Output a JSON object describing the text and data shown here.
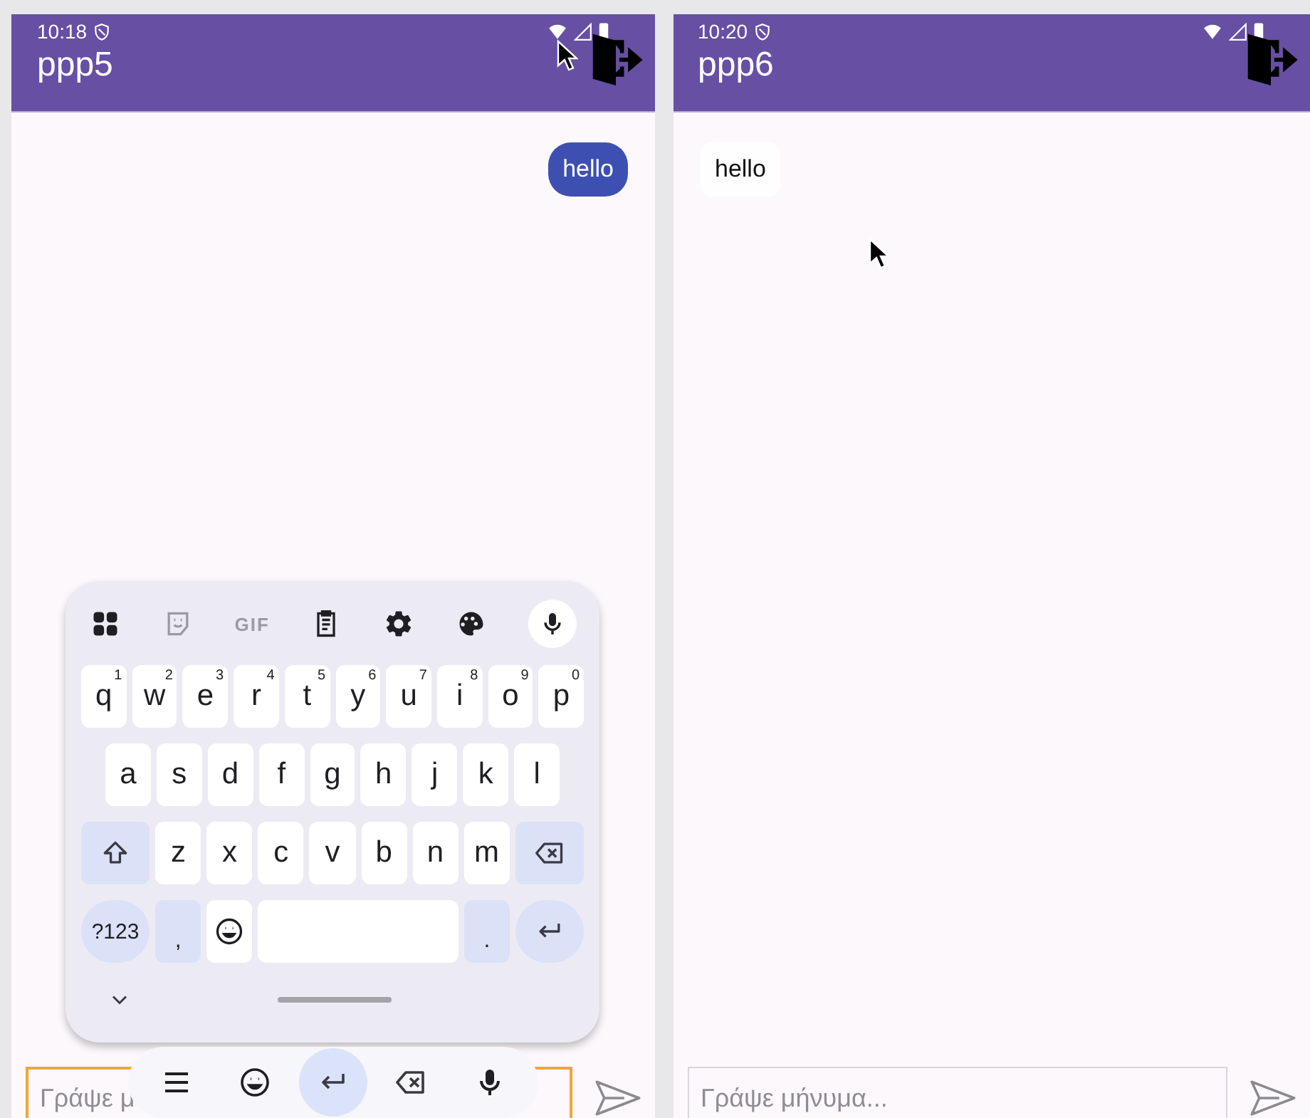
{
  "panels": [
    {
      "status": {
        "time": "10:18"
      },
      "title": "ppp5",
      "messages": [
        {
          "kind": "sent",
          "text": "hello"
        }
      ],
      "input": {
        "placeholder": "Γράψε μ",
        "focused": true
      },
      "keyboard": {
        "toolbar": [
          {
            "kind": "apps"
          },
          {
            "kind": "sticker"
          },
          {
            "kind": "gif",
            "label": "GIF"
          },
          {
            "kind": "clipboard"
          },
          {
            "kind": "settings"
          },
          {
            "kind": "palette"
          },
          {
            "kind": "mic"
          }
        ],
        "rows": [
          {
            "keys": [
              {
                "kind": "letter",
                "label": "q",
                "hint": "1"
              },
              {
                "kind": "letter",
                "label": "w",
                "hint": "2"
              },
              {
                "kind": "letter",
                "label": "e",
                "hint": "3"
              },
              {
                "kind": "letter",
                "label": "r",
                "hint": "4"
              },
              {
                "kind": "letter",
                "label": "t",
                "hint": "5"
              },
              {
                "kind": "letter",
                "label": "y",
                "hint": "6"
              },
              {
                "kind": "letter",
                "label": "u",
                "hint": "7"
              },
              {
                "kind": "letter",
                "label": "i",
                "hint": "8"
              },
              {
                "kind": "letter",
                "label": "o",
                "hint": "9"
              },
              {
                "kind": "letter",
                "label": "p",
                "hint": "0"
              }
            ]
          },
          {
            "keys": [
              {
                "kind": "letter",
                "label": "a"
              },
              {
                "kind": "letter",
                "label": "s"
              },
              {
                "kind": "letter",
                "label": "d"
              },
              {
                "kind": "letter",
                "label": "f"
              },
              {
                "kind": "letter",
                "label": "g"
              },
              {
                "kind": "letter",
                "label": "h"
              },
              {
                "kind": "letter",
                "label": "j"
              },
              {
                "kind": "letter",
                "label": "k"
              },
              {
                "kind": "letter",
                "label": "l"
              }
            ]
          },
          {
            "keys": [
              {
                "kind": "shift"
              },
              {
                "kind": "letter",
                "label": "z"
              },
              {
                "kind": "letter",
                "label": "x"
              },
              {
                "kind": "letter",
                "label": "c"
              },
              {
                "kind": "letter",
                "label": "v"
              },
              {
                "kind": "letter",
                "label": "b"
              },
              {
                "kind": "letter",
                "label": "n"
              },
              {
                "kind": "letter",
                "label": "m"
              },
              {
                "kind": "backspace"
              }
            ]
          },
          {
            "keys": [
              {
                "kind": "symbols",
                "label": "?123"
              },
              {
                "kind": "punct",
                "label": ","
              },
              {
                "kind": "emoji"
              },
              {
                "kind": "space"
              },
              {
                "kind": "punct",
                "label": "."
              },
              {
                "kind": "enter"
              }
            ]
          }
        ],
        "nav": [
          {
            "kind": "menu",
            "selected": false
          },
          {
            "kind": "emoji",
            "selected": false
          },
          {
            "kind": "enter",
            "selected": true
          },
          {
            "kind": "backspace",
            "selected": false
          },
          {
            "kind": "mic",
            "selected": false
          }
        ]
      }
    },
    {
      "status": {
        "time": "10:20"
      },
      "title": "ppp6",
      "messages": [
        {
          "kind": "received",
          "text": "hello"
        }
      ],
      "input": {
        "placeholder": "Γράψε μήνυμα...",
        "focused": false
      }
    }
  ]
}
